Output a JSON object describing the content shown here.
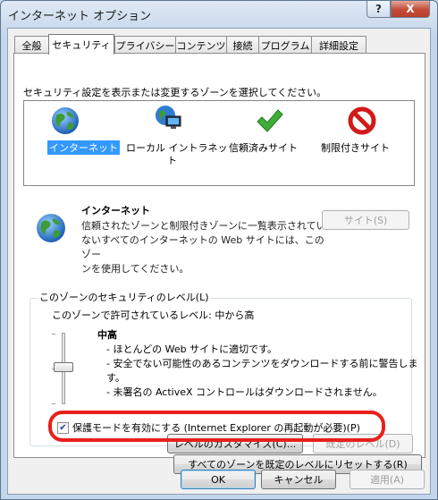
{
  "window": {
    "title": "インターネット オプション",
    "help_label": "?",
    "close_label": "X"
  },
  "tabs": [
    {
      "label": "全般"
    },
    {
      "label": "セキュリティ"
    },
    {
      "label": "プライバシー"
    },
    {
      "label": "コンテンツ"
    },
    {
      "label": "接続"
    },
    {
      "label": "プログラム"
    },
    {
      "label": "詳細設定"
    }
  ],
  "security": {
    "zone_heading": "セキュリティ設定を表示または変更するゾーンを選択してください。",
    "zones": [
      {
        "label": "インターネット",
        "icon": "globe-icon"
      },
      {
        "label_line1": "ローカル イントラネッ",
        "label_line2": "ト",
        "icon": "intranet-icon"
      },
      {
        "label": "信頼済みサイト",
        "icon": "checkmark-icon"
      },
      {
        "label": "制限付きサイト",
        "icon": "restricted-icon"
      }
    ],
    "info_title": "インターネット",
    "info_lines": [
      "信頼されたゾーンと制限付きゾーンに一覧表示されてい",
      "ないすべてのインターネットの Web サイトには、このゾー",
      "ンを使用してください。"
    ],
    "sites_button": "サイト(S)",
    "level_group_title": "このゾーンのセキュリティのレベル(L)",
    "allowed_levels": "このゾーンで許可されているレベル: 中から高",
    "level_name": "中高",
    "level_desc": [
      "- ほとんどの Web サイトに適切です。",
      "- 安全でない可能性のあるコンテンツをダウンロードする前に警告します。",
      "- 未署名の ActiveX コントロールはダウンロードされません。"
    ],
    "protected_mode_label": "保護モードを有効にする (Internet Explorer の再起動が必要)(P)",
    "protected_mode_checked": true,
    "custom_level_button": "レベルのカスタマイズ(C)...",
    "default_level_button": "既定のレベル(D)",
    "reset_all_button": "すべてのゾーンを既定のレベルにリセットする(R)"
  },
  "footer": {
    "ok": "OK",
    "cancel": "キャンセル",
    "apply": "適用(A)"
  },
  "colors": {
    "highlight": "#e8201b",
    "selection": "#3399ff"
  }
}
